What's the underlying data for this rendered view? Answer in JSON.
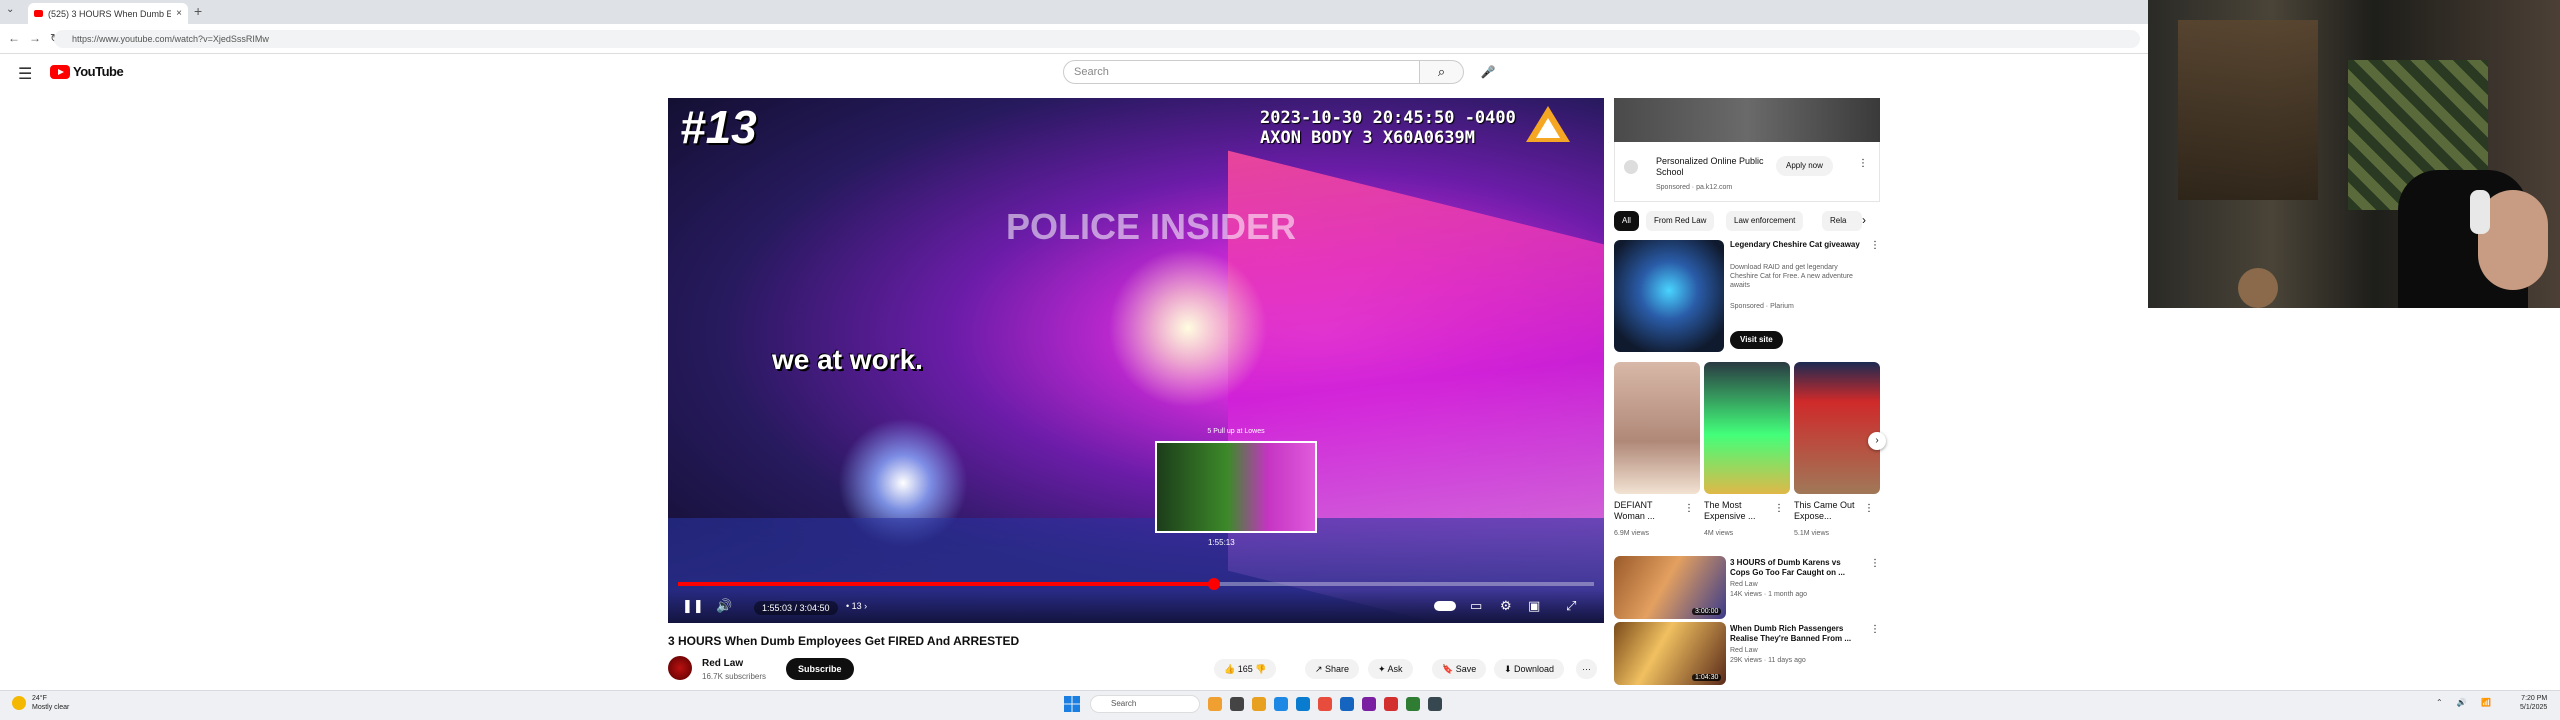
{
  "browser": {
    "tab_title": "(525) 3 HOURS When Dumb E",
    "tab_close": "×",
    "new_tab": "+",
    "tab_menu": "⌄",
    "nav": "←→↻",
    "url": "https://www.youtube.com/watch?v=XjedSssRIMw"
  },
  "header": {
    "menu_icon": "☰",
    "logo_text": "YouTube",
    "search_placeholder": "Search",
    "search_icon": "⌕",
    "mic_icon": "🎤"
  },
  "player": {
    "episode": "#13",
    "timestamp_line1": "2023-10-30 20:45:50 -0400",
    "timestamp_line2": "AXON BODY 3 X60A0639M",
    "watermark": "POLICE INSIDER",
    "caption": "we at work.",
    "preview_title": "5 Pull up at Lowes",
    "preview_time": "1:55:13",
    "progress_fraction": 0.585,
    "time": "1:55:03 / 3:04:50",
    "chapter": "• 13 ›",
    "play_icon": "❚❚",
    "volume_icon": "🔊",
    "cc_icon": "▭",
    "settings_icon": "⚙",
    "miniplayer_icon": "▣",
    "fullscreen_icon": "⤢"
  },
  "video": {
    "title": "3 HOURS When Dumb Employees Get FIRED And ARRESTED",
    "channel": "Red Law",
    "subscribers": "16.7K subscribers",
    "subscribe": "Subscribe",
    "likes": "👍 165",
    "dislike": "👎",
    "share": "↗ Share",
    "ask": "✦ Ask",
    "save": "🔖 Save",
    "download": "⬇ Download",
    "more": "···"
  },
  "sidebar": {
    "ad1": {
      "title": "Personalized Online Public School",
      "sponsor": "Sponsored · pa.k12.com",
      "apply": "Apply now",
      "dots": "⋮"
    },
    "chips": [
      "All",
      "From Red Law",
      "Law enforcement",
      "Rela"
    ],
    "chip_arrow": "›",
    "ad2": {
      "title": "Legendary Cheshire Cat giveaway",
      "desc": "Download RAID and get legendary Cheshire Cat for Free. A new adventure awaits",
      "sponsor": "Sponsored · Plarium",
      "button": "Visit site",
      "dots": "⋮"
    },
    "shelf": [
      {
        "title": "DEFIANT Woman ...",
        "views": "6.9M views",
        "dots": "⋮"
      },
      {
        "title": "The Most Expensive ...",
        "views": "4M views",
        "dots": "⋮"
      },
      {
        "title": "This Came Out Expose...",
        "views": "5.1M views",
        "dots": "⋮"
      }
    ],
    "shelf_next": "›",
    "recs": [
      {
        "title": "3 HOURS of Dumb Karens vs Cops Go Too Far Caught on ...",
        "channel": "Red Law",
        "meta": "14K views · 1 month ago",
        "duration": "3:00:00",
        "dots": "⋮"
      },
      {
        "title": "When Dumb Rich Passengers Realise They're Banned From ...",
        "channel": "Red Law",
        "meta": "29K views · 11 days ago",
        "duration": "1:04:30",
        "dots": "⋮"
      }
    ]
  },
  "taskbar": {
    "weather_temp": "24°F",
    "weather_desc": "Mostly clear",
    "search": "Search",
    "tray": "⌃ 🔊 📶",
    "time": "7:20 PM",
    "date": "5/1/2025",
    "colors": [
      "#f0a030",
      "#444444",
      "#e8a020",
      "#1e88e5",
      "#0a7cd0",
      "#e74c3c",
      "#1565c0",
      "#7b1fa2",
      "#d32f2f",
      "#2e7d32",
      "#37474f"
    ]
  }
}
